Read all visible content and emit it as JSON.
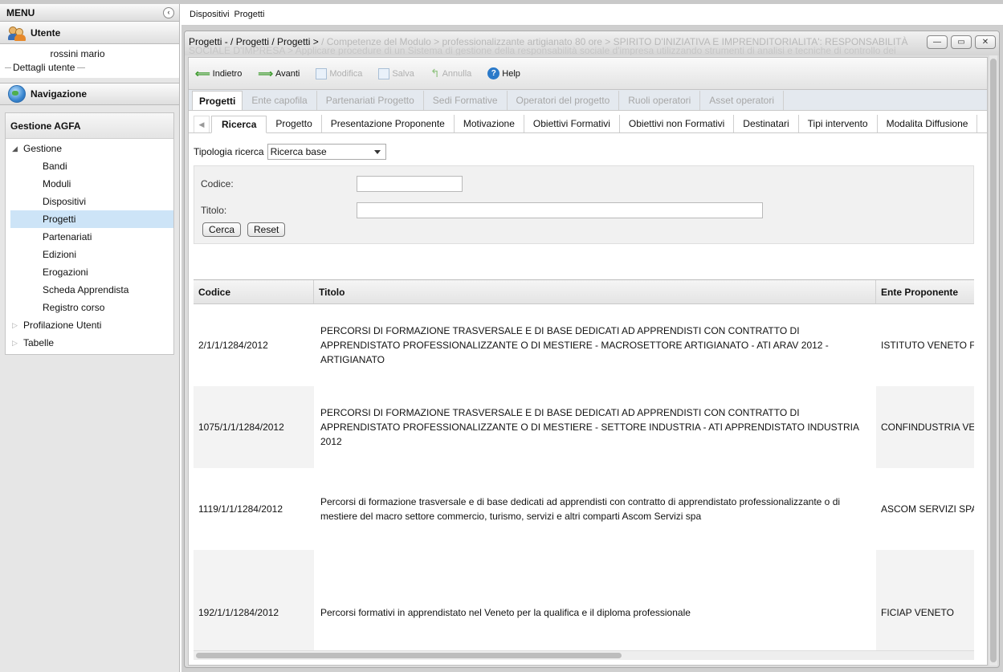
{
  "menu": {
    "title": "MENU",
    "collapse_icon": "‹"
  },
  "user_section": {
    "title": "Utente",
    "name": "rossini mario",
    "details_link": "Dettagli utente"
  },
  "nav_section": {
    "title": "Navigazione"
  },
  "nav_panel": {
    "title": "Gestione AGFA",
    "gestione": "Gestione",
    "items": [
      "Bandi",
      "Moduli",
      "Dispositivi",
      "Progetti",
      "Partenariati",
      "Edizioni",
      "Erogazioni",
      "Scheda Apprendista",
      "Registro corso"
    ],
    "selected": "Progetti",
    "profilazione": "Profilazione Utenti",
    "tabelle": "Tabelle"
  },
  "main_top": {
    "crumb1": "Dispositivi",
    "crumb2": "Progetti"
  },
  "window": {
    "title_main": "Progetti - / Progetti / Progetti >",
    "title_faded": " / Competenze del Modulo > professionalizzante artigianato 80 ore > SPIRITO D'INIZIATIVA E IMPRENDITORIALITA': RESPONSABILITÀ",
    "title_line2": "SOCIALE D'IMPRESA > Applicare procedure di un Sistema di gestione della responsabilità sociale d'impresa utilizzando strumenti di analisi e tecniche di controllo dei",
    "btn_min": "—",
    "btn_max": "▭",
    "btn_close": "✕"
  },
  "toolbar": {
    "indietro": "Indietro",
    "avanti": "Avanti",
    "modifica": "Modifica",
    "salva": "Salva",
    "annulla": "Annulla",
    "help": "Help"
  },
  "tabs_primary": [
    "Progetti",
    "Ente capofila",
    "Partenariati Progetto",
    "Sedi Formative",
    "Operatori del progetto",
    "Ruoli operatori",
    "Asset operatori"
  ],
  "tabs_secondary": [
    "Ricerca",
    "Progetto",
    "Presentazione Proponente",
    "Motivazione",
    "Obiettivi Formativi",
    "Obiettivi non Formativi",
    "Destinatari",
    "Tipi intervento",
    "Modalita Diffusione"
  ],
  "search": {
    "tipologia_label": "Tipologia ricerca",
    "tipologia_value": "Ricerca base",
    "codice_label": "Codice:",
    "codice_value": "",
    "titolo_label": "Titolo:",
    "titolo_value": "",
    "cerca": "Cerca",
    "reset": "Reset"
  },
  "grid": {
    "columns": [
      "Codice",
      "Titolo",
      "Ente Proponente"
    ],
    "rows": [
      {
        "codice": "2/1/1/1284/2012",
        "titolo": "PERCORSI DI FORMAZIONE TRASVERSALE E DI BASE DEDICATI AD APPRENDISTI CON CONTRATTO DI APPRENDISTATO PROFESSIONALIZZANTE O DI MESTIERE - MACROSETTORE ARTIGIANATO - ATI ARAV 2012 - ARTIGIANATO",
        "ente": "ISTITUTO VENETO F"
      },
      {
        "codice": "1075/1/1/1284/2012",
        "titolo": "PERCORSI DI FORMAZIONE TRASVERSALE E DI BASE DEDICATI AD APPRENDISTI CON CONTRATTO DI APPRENDISTATO PROFESSIONALIZZANTE O DI MESTIERE - SETTORE INDUSTRIA - ATI APPRENDISTATO INDUSTRIA 2012",
        "ente": "CONFINDUSTRIA VE"
      },
      {
        "codice": "1119/1/1/1284/2012",
        "titolo": "Percorsi di formazione trasversale e di base dedicati ad apprendisti con contratto di apprendistato professionalizzante o di mestiere del macro settore commercio, turismo, servizi e altri comparti Ascom Servizi spa",
        "ente": "ASCOM SERVIZI SPA"
      },
      {
        "codice": "192/1/1/1284/2012",
        "titolo": "Percorsi formativi in apprendistato nel Veneto per la qualifica e il diploma professionale",
        "ente": "FICIAP VENETO"
      }
    ]
  }
}
